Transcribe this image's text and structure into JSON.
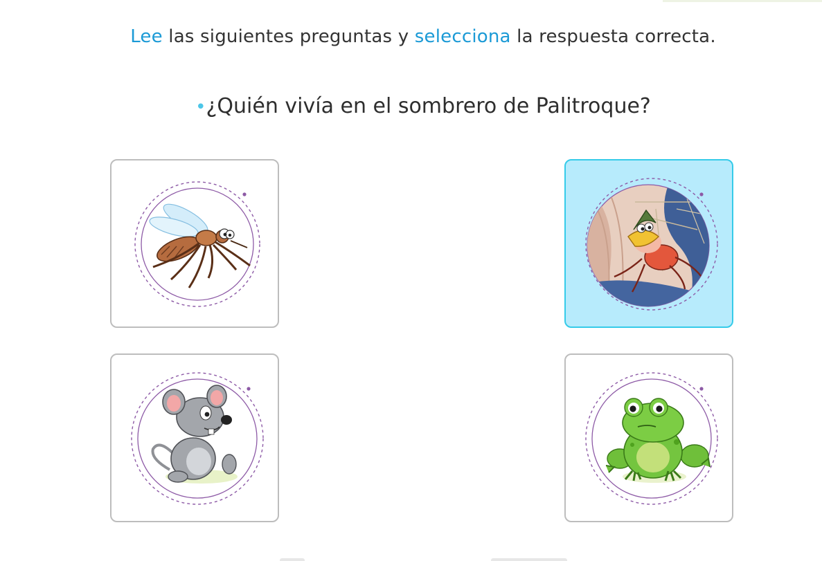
{
  "instruction": {
    "word1": "Lee",
    "text1": " las siguientes preguntas y ",
    "word2": "selecciona",
    "text2": " la respuesta correcta."
  },
  "question": {
    "bullet": "•",
    "text": "¿Quién vivía en el sombrero de Palitroque?"
  },
  "options": [
    {
      "id": "mosquito",
      "icon": "mosquito-icon",
      "selected": false
    },
    {
      "id": "spider",
      "icon": "spider-icon",
      "selected": true
    },
    {
      "id": "mouse",
      "icon": "mouse-icon",
      "selected": false
    },
    {
      "id": "frog",
      "icon": "frog-icon",
      "selected": false
    }
  ],
  "colors": {
    "accent_text": "#1b9ad6",
    "bullet": "#4cc6e8",
    "selected_bg": "#b7ebfc",
    "selected_border": "#35cbe9",
    "card_border": "#bdbdbd",
    "ring": "#8d5aa6"
  }
}
